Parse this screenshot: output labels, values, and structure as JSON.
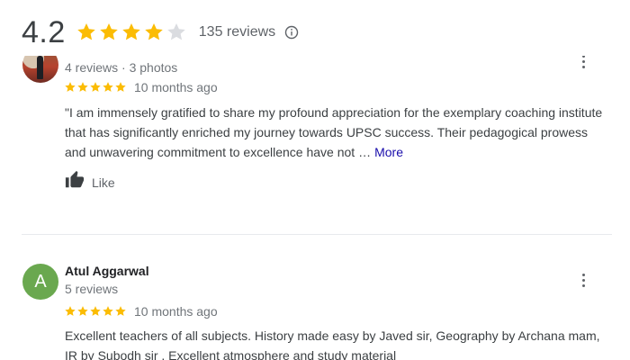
{
  "header": {
    "rating": "4.2",
    "rating_stars": 4.2,
    "review_count": "135 reviews",
    "icons": {
      "info": "info-icon"
    }
  },
  "reviews": [
    {
      "name": "",
      "meta": "4 reviews · 3 photos",
      "stars": 5,
      "time": "10 months ago",
      "text": "\"I am immensely gratified to share my profound appreciation for the exemplary coaching institute that has significantly enriched my journey towards UPSC success. Their pedagogical prowess and unwavering commitment to excellence have not …",
      "more_label": "More",
      "like_label": "Like",
      "avatar": "photo"
    },
    {
      "name": "Atul Aggarwal",
      "meta": "5 reviews",
      "stars": 5,
      "time": "10 months ago",
      "text": "Excellent teachers of all subjects. History made easy by Javed sir, Geography by Archana mam, IR by Subodh sir . Excellent atmosphere and study material",
      "avatar_letter": "A",
      "avatar": "letter"
    }
  ],
  "colors": {
    "star_gold": "#fbbc04",
    "star_empty": "#dadce0",
    "link_blue": "#1a0dab",
    "avatar_green": "#6aa84f",
    "muted_text": "#70757a"
  }
}
